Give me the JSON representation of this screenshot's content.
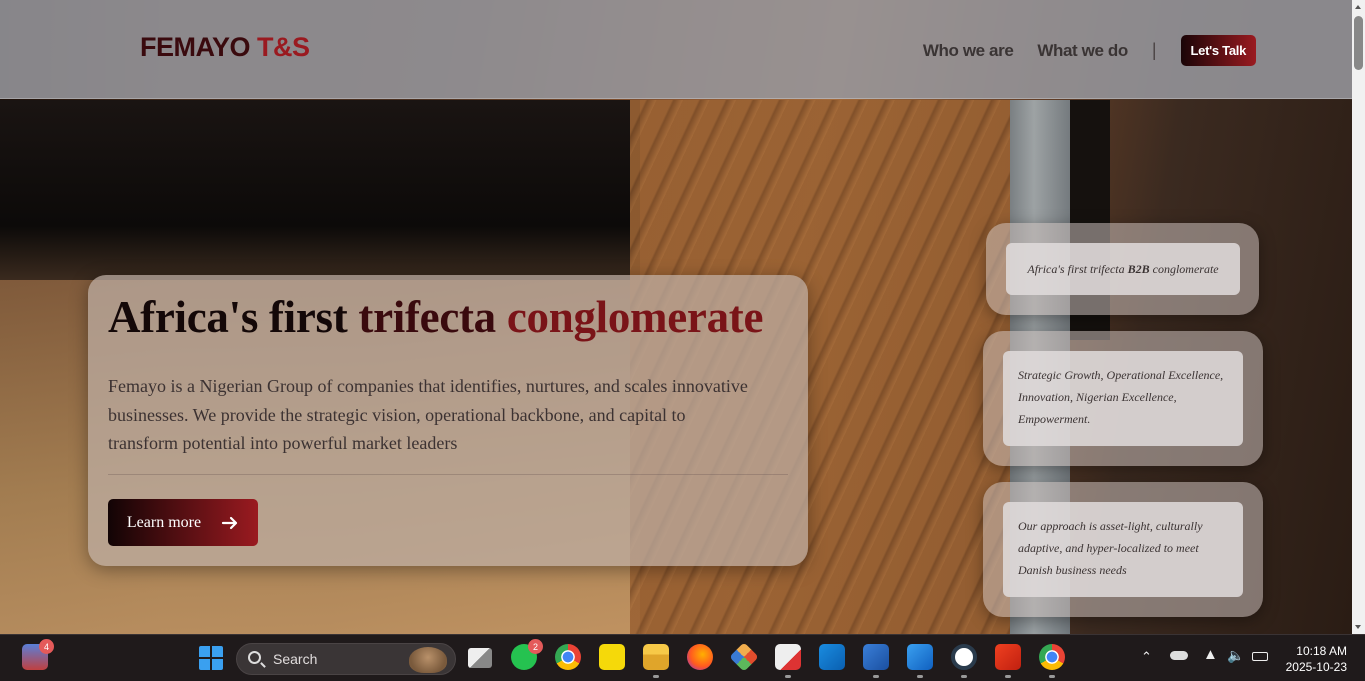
{
  "header": {
    "logo_part1": "FEMAYO ",
    "logo_part2": "T&S",
    "nav": [
      "Who we are",
      "What we do"
    ],
    "separator": "|",
    "cta": "Let's Talk"
  },
  "hero": {
    "title_1": "Africa's first ",
    "title_2": "trifecta ",
    "title_3": "conglomerate",
    "description": "Femayo is a Nigerian Group of companies that identifies, nurtures, and scales innovative businesses. We provide the strategic vision, operational backbone, and capital to transform potential into powerful market leaders",
    "button": "Learn more"
  },
  "cards": {
    "card1_a": "Africa's first trifecta ",
    "card1_b": "B2B",
    "card1_c": " conglomerate",
    "card2": "Strategic Growth, Operational Excellence, Innovation, Nigerian Excellence, Empowerment.",
    "card3": "Our approach is asset-light, culturally adaptive, and hyper-localized to meet Danish business needs"
  },
  "taskbar": {
    "search_label": "Search",
    "widget_badge": "4",
    "whatsapp_badge": "2",
    "time": "10:18 AM",
    "date": "2025-10-23",
    "icons": [
      "weather-widget-icon",
      "windows-start-icon",
      "task-view-icon",
      "whatsapp-icon",
      "chrome-icon",
      "sticky-app-icon",
      "file-explorer-icon",
      "firefox-icon",
      "git-icon",
      "snipping-tool-icon",
      "outlook-icon",
      "word-icon",
      "vscode-icon",
      "wordpress-icon",
      "app-icon",
      "chrome-profile-icon"
    ]
  },
  "colors": {
    "brand_dark": "#3a0a0e",
    "brand_red": "#9a1a20"
  }
}
